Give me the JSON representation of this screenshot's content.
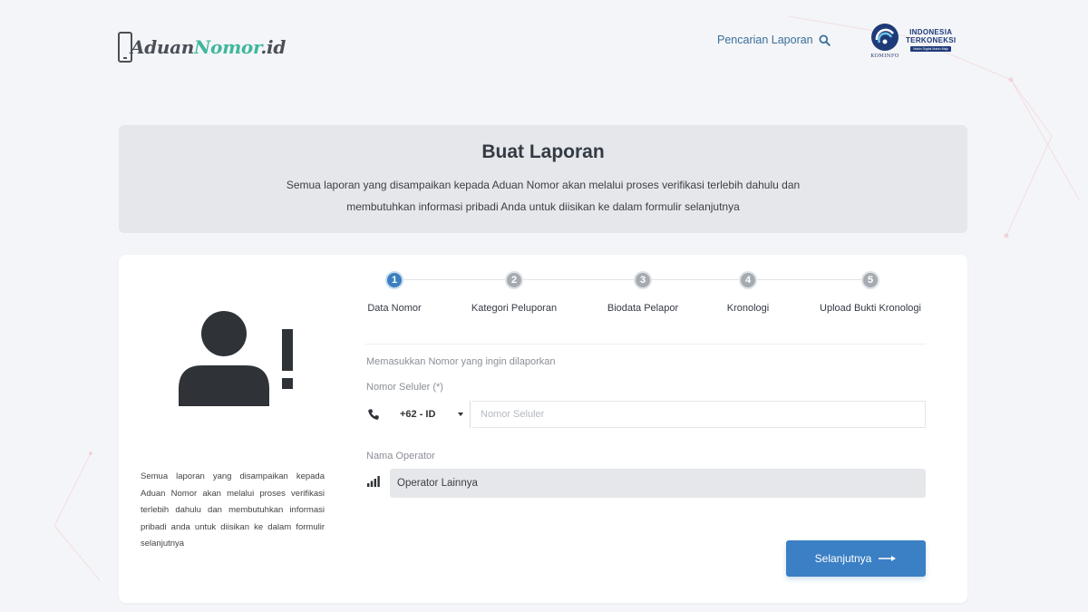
{
  "header": {
    "logo": {
      "part1": "Aduan",
      "part2": "Nomor",
      "part3": ".id"
    },
    "search_label": "Pencarian Laporan",
    "partner": {
      "emblem_text": "KOMINFO",
      "line1": "INDONESIA",
      "line2": "TERKONEKSI",
      "tagline": "Makin Digital Makin Maju"
    }
  },
  "banner": {
    "title": "Buat Laporan",
    "desc_line1": "Semua laporan yang disampaikan kepada Aduan Nomor akan melalui proses verifikasi terlebih dahulu dan",
    "desc_line2": "membutuhkan informasi pribadi Anda untuk diisikan ke dalam formulir selanjutnya"
  },
  "left_panel": {
    "desc": "Semua laporan yang disampaikan kepada Aduan Nomor akan melalui proses verifikasi terlebih dahulu dan membutuhkan informasi pribadi anda untuk diisikan ke dalam formulir selanjutnya"
  },
  "steps": [
    {
      "num": "1",
      "label": "Data Nomor",
      "active": true
    },
    {
      "num": "2",
      "label": "Kategori Peluporan",
      "active": false
    },
    {
      "num": "3",
      "label": "Biodata Pelapor",
      "active": false
    },
    {
      "num": "4",
      "label": "Kronologi",
      "active": false
    },
    {
      "num": "5",
      "label": "Upload Bukti Kronologi",
      "active": false
    }
  ],
  "form": {
    "hint": "Memasukkan Nomor yang ingin dilaporkan",
    "phone_label": "Nomor Seluler (*)",
    "country_code": "+62 - ID",
    "phone_placeholder": "Nomor Seluler",
    "operator_label": "Nama Operator",
    "operator_value": "Operator Lainnya",
    "next_label": "Selanjutnya"
  },
  "colors": {
    "accent": "#3b7fc4",
    "brand_green": "#3fb79c",
    "step_inactive": "#a6abb2",
    "banner_bg": "#e5e7ea"
  },
  "icons": [
    "search-icon",
    "user-alert-icon",
    "phone-icon",
    "signal-icon",
    "arrow-right-icon",
    "chevron-down-icon"
  ]
}
